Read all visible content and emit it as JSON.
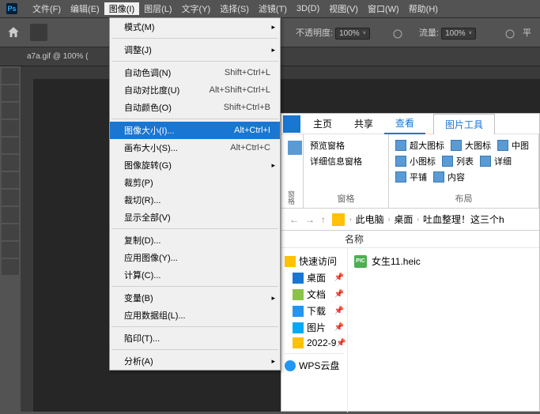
{
  "menubar": [
    "文件(F)",
    "编辑(E)",
    "图像(I)",
    "图层(L)",
    "文字(Y)",
    "选择(S)",
    "滤镜(T)",
    "3D(D)",
    "视图(V)",
    "窗口(W)",
    "帮助(H)"
  ],
  "options": {
    "opacity_label": "不透明度:",
    "opacity_value": "100%",
    "flow_label": "流量:",
    "flow_value": "100%",
    "smooth_label": "平"
  },
  "doc_tab": "a7a.gif @ 100% (",
  "dropdown": {
    "mode": {
      "label": "模式(M)"
    },
    "adjust": {
      "label": "调整(J)"
    },
    "autotone": {
      "label": "自动色调(N)",
      "shortcut": "Shift+Ctrl+L"
    },
    "autocontrast": {
      "label": "自动对比度(U)",
      "shortcut": "Alt+Shift+Ctrl+L"
    },
    "autocolor": {
      "label": "自动颜色(O)",
      "shortcut": "Shift+Ctrl+B"
    },
    "imagesize": {
      "label": "图像大小(I)...",
      "shortcut": "Alt+Ctrl+I"
    },
    "canvassize": {
      "label": "画布大小(S)...",
      "shortcut": "Alt+Ctrl+C"
    },
    "rotation": {
      "label": "图像旋转(G)"
    },
    "crop": {
      "label": "裁剪(P)"
    },
    "trim": {
      "label": "裁切(R)..."
    },
    "reveal": {
      "label": "显示全部(V)"
    },
    "duplicate": {
      "label": "复制(D)..."
    },
    "apply": {
      "label": "应用图像(Y)..."
    },
    "calc": {
      "label": "计算(C)..."
    },
    "variables": {
      "label": "变量(B)"
    },
    "datasets": {
      "label": "应用数据组(L)..."
    },
    "trap": {
      "label": "陷印(T)..."
    },
    "analysis": {
      "label": "分析(A)"
    }
  },
  "explorer": {
    "tabs": {
      "home": "主页",
      "share": "共享",
      "view": "查看",
      "pictools": "图片工具"
    },
    "ribbon": {
      "pane_label": "窗格",
      "layout_label": "布局",
      "preview_pane": "预览窗格",
      "details_pane": "详细信息窗格",
      "xl_icons": "超大图标",
      "l_icons": "大图标",
      "m_icons": "中图",
      "s_icons": "小图标",
      "list": "列表",
      "details": "详细",
      "tiles": "平铺",
      "content": "内容"
    },
    "breadcrumb": {
      "pc": "此电脑",
      "desktop": "桌面",
      "folder": "吐血整理！这三个h"
    },
    "col_name": "名称",
    "sidebar": {
      "quick": "快速访问",
      "desktop": "桌面",
      "docs": "文档",
      "downloads": "下载",
      "pictures": "图片",
      "folder": "2022-9",
      "wps": "WPS云盘"
    },
    "file": {
      "name": "女生11.heic"
    }
  }
}
